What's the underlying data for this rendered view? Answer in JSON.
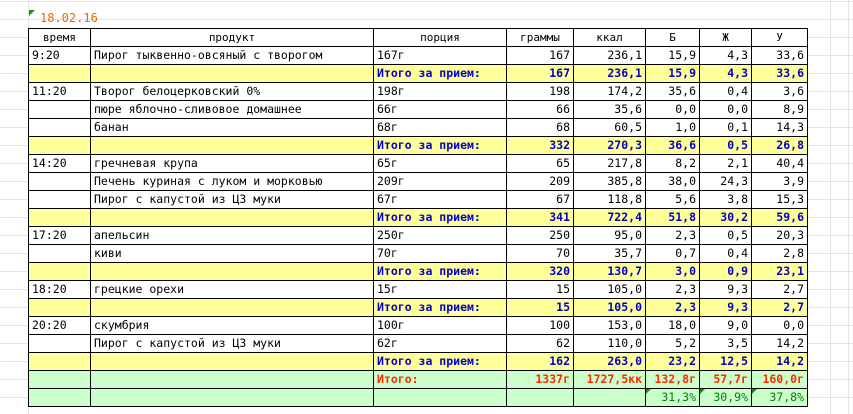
{
  "sheet": {
    "date": "18.02.16",
    "headers": [
      "время",
      "продукт",
      "порция",
      "граммы",
      "ккал",
      "Б",
      "Ж",
      "У"
    ],
    "meals": [
      {
        "time": "9:20",
        "items": [
          {
            "product": "Пирог тыквенно-овсяный с творогом",
            "portion": "167г",
            "grams": "167",
            "kcal": "236,1",
            "b": "15,9",
            "zh": "4,3",
            "u": "33,6"
          }
        ],
        "total": {
          "label": "Итого за прием:",
          "grams": "167",
          "kcal": "236,1",
          "b": "15,9",
          "zh": "4,3",
          "u": "33,6"
        }
      },
      {
        "time": "11:20",
        "items": [
          {
            "product": "Творог белоцерковский 0%",
            "portion": "198г",
            "grams": "198",
            "kcal": "174,2",
            "b": "35,6",
            "zh": "0,4",
            "u": "3,6"
          },
          {
            "product": "пюре яблочно-сливовое домашнее",
            "portion": "66г",
            "grams": "66",
            "kcal": "35,6",
            "b": "0,0",
            "zh": "0,0",
            "u": "8,9"
          },
          {
            "product": "банан",
            "portion": "68г",
            "grams": "68",
            "kcal": "60,5",
            "b": "1,0",
            "zh": "0,1",
            "u": "14,3"
          }
        ],
        "total": {
          "label": "Итого за прием:",
          "grams": "332",
          "kcal": "270,3",
          "b": "36,6",
          "zh": "0,5",
          "u": "26,8"
        }
      },
      {
        "time": "14:20",
        "items": [
          {
            "product": "гречневая крупа",
            "portion": "65г",
            "grams": "65",
            "kcal": "217,8",
            "b": "8,2",
            "zh": "2,1",
            "u": "40,4"
          },
          {
            "product": "Печень куриная с луком и морковью",
            "portion": "209г",
            "grams": "209",
            "kcal": "385,8",
            "b": "38,0",
            "zh": "24,3",
            "u": "3,9"
          },
          {
            "product": "Пирог с капустой из ЦЗ муки",
            "portion": "67г",
            "grams": "67",
            "kcal": "118,8",
            "b": "5,6",
            "zh": "3,8",
            "u": "15,3"
          }
        ],
        "total": {
          "label": "Итого за прием:",
          "grams": "341",
          "kcal": "722,4",
          "b": "51,8",
          "zh": "30,2",
          "u": "59,6"
        }
      },
      {
        "time": "17:20",
        "items": [
          {
            "product": "апельсин",
            "portion": "250г",
            "grams": "250",
            "kcal": "95,0",
            "b": "2,3",
            "zh": "0,5",
            "u": "20,3"
          },
          {
            "product": "киви",
            "portion": "70г",
            "grams": "70",
            "kcal": "35,7",
            "b": "0,7",
            "zh": "0,4",
            "u": "2,8"
          }
        ],
        "total": {
          "label": "Итого за прием:",
          "grams": "320",
          "kcal": "130,7",
          "b": "3,0",
          "zh": "0,9",
          "u": "23,1"
        }
      },
      {
        "time": "18:20",
        "items": [
          {
            "product": "грецкие орехи",
            "portion": "15г",
            "grams": "15",
            "kcal": "105,0",
            "b": "2,3",
            "zh": "9,3",
            "u": "2,7"
          }
        ],
        "total": {
          "label": "Итого за прием:",
          "grams": "15",
          "kcal": "105,0",
          "b": "2,3",
          "zh": "9,3",
          "u": "2,7"
        }
      },
      {
        "time": "20:20",
        "items": [
          {
            "product": "скумбрия",
            "portion": "100г",
            "grams": "100",
            "kcal": "153,0",
            "b": "18,0",
            "zh": "9,0",
            "u": "0,0"
          },
          {
            "product": "Пирог с капустой из ЦЗ муки",
            "portion": "62г",
            "grams": "62",
            "kcal": "110,0",
            "b": "5,2",
            "zh": "3,5",
            "u": "14,2"
          }
        ],
        "total": {
          "label": "Итого за прием:",
          "grams": "162",
          "kcal": "263,0",
          "b": "23,2",
          "zh": "12,5",
          "u": "14,2"
        }
      }
    ],
    "grand_total": {
      "label": "Итого:",
      "grams": "1337г",
      "kcal": "1727,5кк",
      "b": "132,8г",
      "zh": "57,7г",
      "u": "160,0г"
    },
    "percent": {
      "b": "31,3%",
      "zh": "30,9%",
      "u": "37,8%"
    }
  }
}
